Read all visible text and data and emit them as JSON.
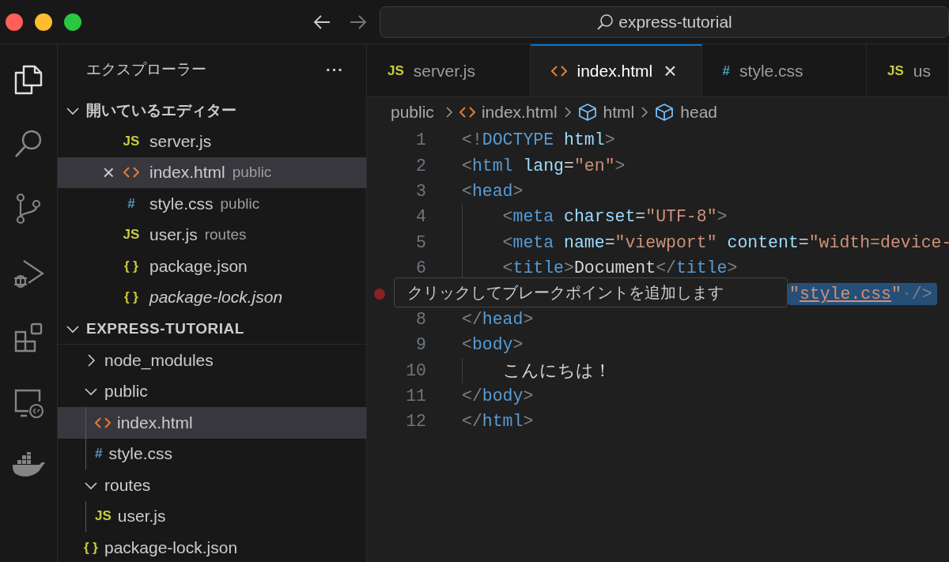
{
  "window": {
    "search": "express-tutorial"
  },
  "sidebar": {
    "title": "エクスプローラー",
    "more": "···",
    "open_editors": {
      "title": "開いているエディター",
      "expanded": true,
      "items": [
        {
          "kind": "js",
          "badge": "JS",
          "name": "server.js",
          "selected": false,
          "italic": false
        },
        {
          "kind": "html",
          "name": "index.html",
          "detail": "public",
          "close": "×",
          "selected": true,
          "italic": false
        },
        {
          "kind": "css",
          "badge": "#",
          "name": "style.css",
          "detail": "public",
          "selected": false,
          "italic": false
        },
        {
          "kind": "js",
          "badge": "JS",
          "name": "user.js",
          "detail": "routes",
          "selected": false,
          "italic": false
        },
        {
          "kind": "json",
          "badge": "{ }",
          "name": "package.json",
          "selected": false,
          "italic": false
        },
        {
          "kind": "json",
          "badge": "{ }",
          "name": "package-lock.json",
          "selected": false,
          "italic": true
        }
      ]
    },
    "project": {
      "title": "EXPRESS-TUTORIAL",
      "expanded": true,
      "children": [
        {
          "kind": "folder",
          "name": "node_modules",
          "expanded": false,
          "selected": false
        },
        {
          "kind": "folder",
          "name": "public",
          "expanded": true,
          "selected": false,
          "children": [
            {
              "kind": "html",
              "name": "index.html",
              "selected": true
            },
            {
              "kind": "css",
              "badge": "#",
              "name": "style.css",
              "selected": false
            }
          ]
        },
        {
          "kind": "folder",
          "name": "routes",
          "expanded": true,
          "selected": false,
          "children": [
            {
              "kind": "js",
              "badge": "JS",
              "name": "user.js",
              "selected": false
            }
          ]
        },
        {
          "kind": "json",
          "badge": "{ }",
          "name": "package-lock.json",
          "selected": false
        }
      ]
    }
  },
  "tabs": [
    {
      "kind": "js",
      "badge": "JS",
      "name": "server.js",
      "selected": false
    },
    {
      "kind": "html",
      "name": "index.html",
      "close": "×",
      "selected": true
    },
    {
      "kind": "css",
      "badge": "#",
      "name": "style.css",
      "selected": false
    },
    {
      "kind": "js",
      "badge": "JS",
      "name": "us",
      "selected": false
    }
  ],
  "breadcrumbs": [
    {
      "kind": "folder",
      "label": "public"
    },
    {
      "kind": "html",
      "label": "index.html"
    },
    {
      "kind": "element",
      "label": "html"
    },
    {
      "kind": "element",
      "label": "head"
    }
  ],
  "code": [
    {
      "number": "1",
      "guide": false,
      "tokens": [
        {
          "kind": "p",
          "text": "<!"
        },
        {
          "kind": "t",
          "text": "DOCTYPE"
        },
        {
          "kind": "a",
          "text": " html"
        },
        {
          "kind": "p",
          "text": ">"
        }
      ]
    },
    {
      "number": "2",
      "guide": false,
      "tokens": [
        {
          "kind": "p",
          "text": "<"
        },
        {
          "kind": "t",
          "text": "html"
        },
        {
          "kind": "a",
          "text": " lang"
        },
        {
          "kind": "x",
          "text": "="
        },
        {
          "kind": "s",
          "text": "\"en\""
        },
        {
          "kind": "p",
          "text": ">"
        }
      ]
    },
    {
      "number": "3",
      "guide": false,
      "tokens": [
        {
          "kind": "p",
          "text": "<"
        },
        {
          "kind": "t",
          "text": "head"
        },
        {
          "kind": "p",
          "text": ">"
        }
      ]
    },
    {
      "number": "4",
      "guide": true,
      "tokens": [
        {
          "kind": "p",
          "text": "    <"
        },
        {
          "kind": "t",
          "text": "meta"
        },
        {
          "kind": "a",
          "text": " charset"
        },
        {
          "kind": "x",
          "text": "="
        },
        {
          "kind": "s",
          "text": "\"UTF-8\""
        },
        {
          "kind": "p",
          "text": ">"
        }
      ]
    },
    {
      "number": "5",
      "guide": true,
      "tokens": [
        {
          "kind": "p",
          "text": "    <"
        },
        {
          "kind": "t",
          "text": "meta"
        },
        {
          "kind": "a",
          "text": " name"
        },
        {
          "kind": "x",
          "text": "="
        },
        {
          "kind": "s",
          "text": "\"viewport\""
        },
        {
          "kind": "a",
          "text": " content"
        },
        {
          "kind": "x",
          "text": "="
        },
        {
          "kind": "s",
          "text": "\"width=device-"
        }
      ]
    },
    {
      "number": "6",
      "guide": true,
      "tokens": [
        {
          "kind": "p",
          "text": "    <"
        },
        {
          "kind": "t",
          "text": "title"
        },
        {
          "kind": "p",
          "text": ">"
        },
        {
          "kind": "x",
          "text": "Document"
        },
        {
          "kind": "p",
          "text": "</"
        },
        {
          "kind": "t",
          "text": "title"
        },
        {
          "kind": "p",
          "text": ">"
        }
      ]
    },
    {
      "covered": true,
      "breakpoint_hint": true,
      "selected": true,
      "guide": false,
      "tokens": [
        {
          "kind": "s",
          "text": "\""
        },
        {
          "kind": "l",
          "text": "style.css"
        },
        {
          "kind": "s",
          "text": "\""
        },
        {
          "kind": "w",
          "text": "·"
        },
        {
          "kind": "p",
          "text": "/>"
        }
      ]
    },
    {
      "number": "8",
      "guide": false,
      "tokens": [
        {
          "kind": "p",
          "text": "</"
        },
        {
          "kind": "t",
          "text": "head"
        },
        {
          "kind": "p",
          "text": ">"
        }
      ]
    },
    {
      "number": "9",
      "guide": false,
      "tokens": [
        {
          "kind": "p",
          "text": "<"
        },
        {
          "kind": "t",
          "text": "body"
        },
        {
          "kind": "p",
          "text": ">"
        }
      ]
    },
    {
      "number": "10",
      "guide": true,
      "tokens": [
        {
          "kind": "x",
          "text": "    こんにちは！"
        }
      ]
    },
    {
      "number": "11",
      "guide": false,
      "tokens": [
        {
          "kind": "p",
          "text": "</"
        },
        {
          "kind": "t",
          "text": "body"
        },
        {
          "kind": "p",
          "text": ">"
        }
      ]
    },
    {
      "number": "12",
      "guide": false,
      "tokens": [
        {
          "kind": "p",
          "text": "</"
        },
        {
          "kind": "t",
          "text": "html"
        },
        {
          "kind": "p",
          "text": ">"
        }
      ]
    }
  ],
  "tooltip": "クリックしてブレークポイントを追加します"
}
